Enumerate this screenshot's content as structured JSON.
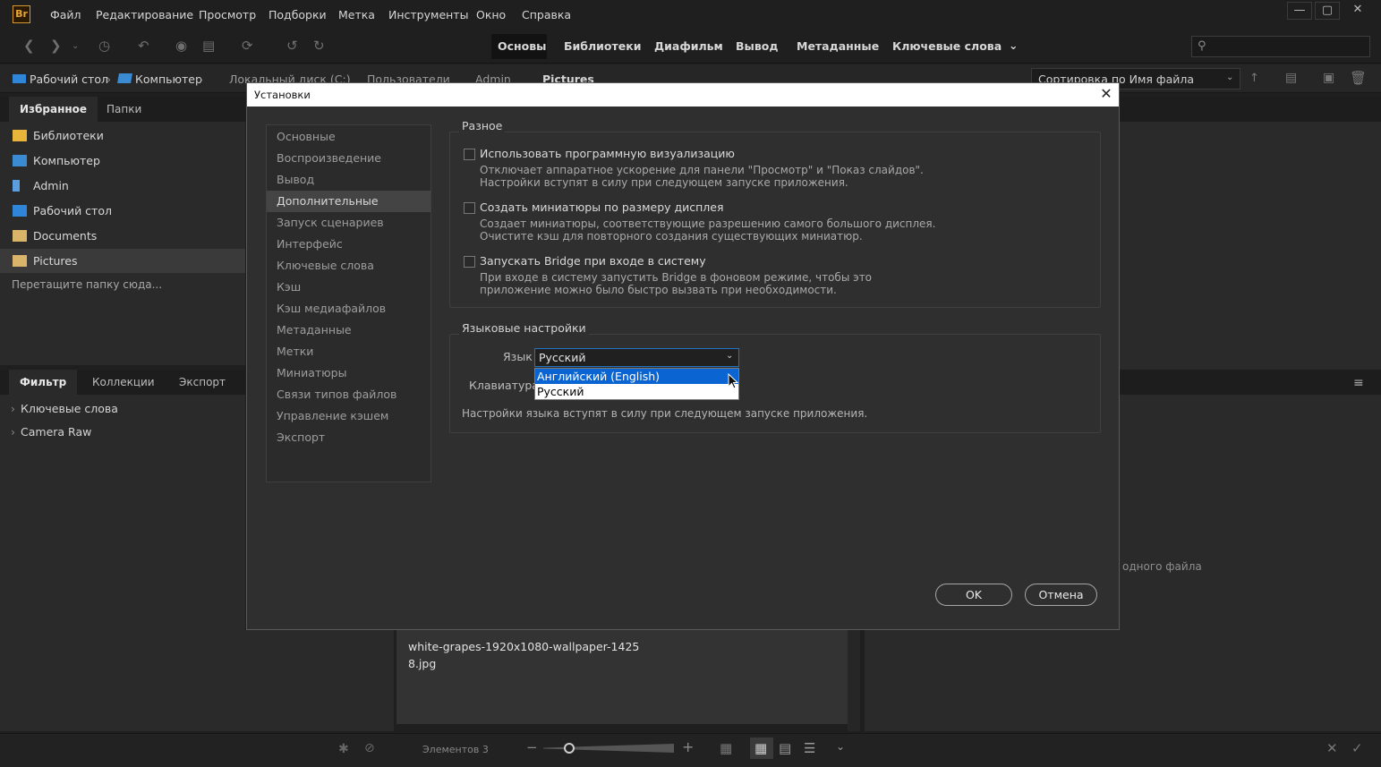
{
  "app": {
    "logo": "Br",
    "menu": [
      "Файл",
      "Редактирование",
      "Просмотр",
      "Подборки",
      "Метка",
      "Инструменты",
      "Окно",
      "Справка"
    ]
  },
  "workspaces": [
    "Основы",
    "Библиотеки",
    "Диафильм",
    "Вывод",
    "Метаданные",
    "Ключевые слова"
  ],
  "search": {
    "placeholder": ""
  },
  "path": [
    "Рабочий стол",
    "Компьютер",
    "Локальный диск (C:)",
    "Пользователи",
    "Admin",
    "Pictures"
  ],
  "sort": {
    "label": "Сортировка по Имя файла"
  },
  "favorites": {
    "tabs": [
      "Избранное",
      "Папки"
    ],
    "items": [
      "Библиотеки",
      "Компьютер",
      "Admin",
      "Рабочий стол",
      "Documents",
      "Pictures"
    ],
    "drop_hint": "Перетащите папку сюда..."
  },
  "filter": {
    "tabs": [
      "Фильтр",
      "Коллекции",
      "Экспорт"
    ],
    "items": [
      "Ключевые слова",
      "Camera Raw"
    ]
  },
  "content": {
    "filename_line1": "white-grapes-1920x1080-wallpaper-1425",
    "filename_line2": "8.jpg",
    "preview_hint": "одного файла",
    "items_count": "Элементов 3"
  },
  "dialog": {
    "title": "Установки",
    "nav": [
      "Основные",
      "Воспроизведение",
      "Вывод",
      "Дополнительные",
      "Запуск сценариев",
      "Интерфейс",
      "Ключевые слова",
      "Кэш",
      "Кэш медиафайлов",
      "Метаданные",
      "Метки",
      "Миниатюры",
      "Связи типов файлов",
      "Управление кэшем",
      "Экспорт"
    ],
    "selected_nav": "Дополнительные",
    "misc": {
      "title": "Разное",
      "options": [
        {
          "label": "Использовать программную визуализацию",
          "checked": false,
          "desc1": "Отключает аппаратное ускорение для панели \"Просмотр\" и \"Показ слайдов\".",
          "desc2": "Настройки вступят в силу при следующем запуске приложения."
        },
        {
          "label": "Создать миниатюры по размеру дисплея",
          "checked": false,
          "desc1": "Создает миниатюры, соответствующие разрешению самого большого дисплея.",
          "desc2": "Очистите кэш для повторного создания существующих миниатюр."
        },
        {
          "label": "Запускать Bridge при входе в систему",
          "checked": false,
          "desc1": "При входе в систему запустить Bridge в фоновом режиме, чтобы это",
          "desc2": "приложение можно было быстро вызвать при необходимости."
        }
      ]
    },
    "language": {
      "title": "Языковые настройки",
      "lang_label": "Язык",
      "lang_value": "Русский",
      "keyboard_label": "Клавиатура",
      "options": [
        "Английский (English)",
        "Русский"
      ],
      "note": "Настройки языка вступят в силу при следующем запуске приложения."
    },
    "ok": "OK",
    "cancel": "Отмена"
  },
  "colors": {
    "accent": "#0a64d2",
    "folder": "#e8b53a",
    "drive": "#3d8fd6"
  }
}
